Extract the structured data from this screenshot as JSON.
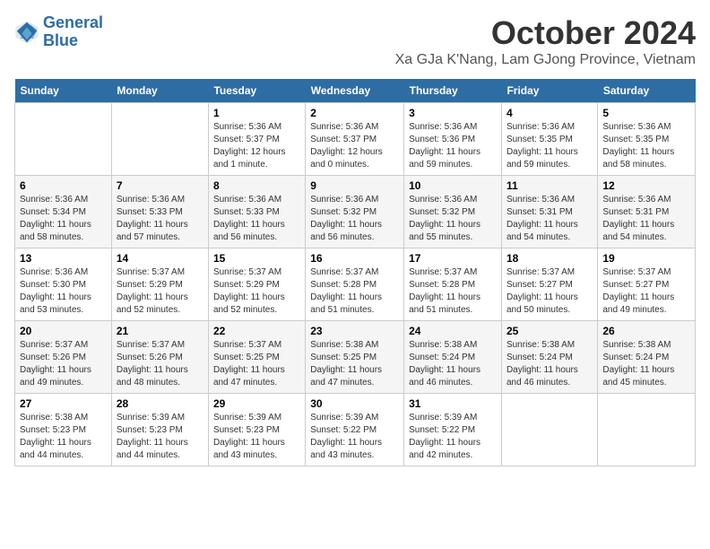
{
  "logo": {
    "line1": "General",
    "line2": "Blue"
  },
  "title": "October 2024",
  "location": "Xa GJa K'Nang, Lam GJong Province, Vietnam",
  "days_of_week": [
    "Sunday",
    "Monday",
    "Tuesday",
    "Wednesday",
    "Thursday",
    "Friday",
    "Saturday"
  ],
  "weeks": [
    [
      {
        "day": "",
        "sunrise": "",
        "sunset": "",
        "daylight": ""
      },
      {
        "day": "",
        "sunrise": "",
        "sunset": "",
        "daylight": ""
      },
      {
        "day": "1",
        "sunrise": "Sunrise: 5:36 AM",
        "sunset": "Sunset: 5:37 PM",
        "daylight": "Daylight: 12 hours and 1 minute."
      },
      {
        "day": "2",
        "sunrise": "Sunrise: 5:36 AM",
        "sunset": "Sunset: 5:37 PM",
        "daylight": "Daylight: 12 hours and 0 minutes."
      },
      {
        "day": "3",
        "sunrise": "Sunrise: 5:36 AM",
        "sunset": "Sunset: 5:36 PM",
        "daylight": "Daylight: 11 hours and 59 minutes."
      },
      {
        "day": "4",
        "sunrise": "Sunrise: 5:36 AM",
        "sunset": "Sunset: 5:35 PM",
        "daylight": "Daylight: 11 hours and 59 minutes."
      },
      {
        "day": "5",
        "sunrise": "Sunrise: 5:36 AM",
        "sunset": "Sunset: 5:35 PM",
        "daylight": "Daylight: 11 hours and 58 minutes."
      }
    ],
    [
      {
        "day": "6",
        "sunrise": "Sunrise: 5:36 AM",
        "sunset": "Sunset: 5:34 PM",
        "daylight": "Daylight: 11 hours and 58 minutes."
      },
      {
        "day": "7",
        "sunrise": "Sunrise: 5:36 AM",
        "sunset": "Sunset: 5:33 PM",
        "daylight": "Daylight: 11 hours and 57 minutes."
      },
      {
        "day": "8",
        "sunrise": "Sunrise: 5:36 AM",
        "sunset": "Sunset: 5:33 PM",
        "daylight": "Daylight: 11 hours and 56 minutes."
      },
      {
        "day": "9",
        "sunrise": "Sunrise: 5:36 AM",
        "sunset": "Sunset: 5:32 PM",
        "daylight": "Daylight: 11 hours and 56 minutes."
      },
      {
        "day": "10",
        "sunrise": "Sunrise: 5:36 AM",
        "sunset": "Sunset: 5:32 PM",
        "daylight": "Daylight: 11 hours and 55 minutes."
      },
      {
        "day": "11",
        "sunrise": "Sunrise: 5:36 AM",
        "sunset": "Sunset: 5:31 PM",
        "daylight": "Daylight: 11 hours and 54 minutes."
      },
      {
        "day": "12",
        "sunrise": "Sunrise: 5:36 AM",
        "sunset": "Sunset: 5:31 PM",
        "daylight": "Daylight: 11 hours and 54 minutes."
      }
    ],
    [
      {
        "day": "13",
        "sunrise": "Sunrise: 5:36 AM",
        "sunset": "Sunset: 5:30 PM",
        "daylight": "Daylight: 11 hours and 53 minutes."
      },
      {
        "day": "14",
        "sunrise": "Sunrise: 5:37 AM",
        "sunset": "Sunset: 5:29 PM",
        "daylight": "Daylight: 11 hours and 52 minutes."
      },
      {
        "day": "15",
        "sunrise": "Sunrise: 5:37 AM",
        "sunset": "Sunset: 5:29 PM",
        "daylight": "Daylight: 11 hours and 52 minutes."
      },
      {
        "day": "16",
        "sunrise": "Sunrise: 5:37 AM",
        "sunset": "Sunset: 5:28 PM",
        "daylight": "Daylight: 11 hours and 51 minutes."
      },
      {
        "day": "17",
        "sunrise": "Sunrise: 5:37 AM",
        "sunset": "Sunset: 5:28 PM",
        "daylight": "Daylight: 11 hours and 51 minutes."
      },
      {
        "day": "18",
        "sunrise": "Sunrise: 5:37 AM",
        "sunset": "Sunset: 5:27 PM",
        "daylight": "Daylight: 11 hours and 50 minutes."
      },
      {
        "day": "19",
        "sunrise": "Sunrise: 5:37 AM",
        "sunset": "Sunset: 5:27 PM",
        "daylight": "Daylight: 11 hours and 49 minutes."
      }
    ],
    [
      {
        "day": "20",
        "sunrise": "Sunrise: 5:37 AM",
        "sunset": "Sunset: 5:26 PM",
        "daylight": "Daylight: 11 hours and 49 minutes."
      },
      {
        "day": "21",
        "sunrise": "Sunrise: 5:37 AM",
        "sunset": "Sunset: 5:26 PM",
        "daylight": "Daylight: 11 hours and 48 minutes."
      },
      {
        "day": "22",
        "sunrise": "Sunrise: 5:37 AM",
        "sunset": "Sunset: 5:25 PM",
        "daylight": "Daylight: 11 hours and 47 minutes."
      },
      {
        "day": "23",
        "sunrise": "Sunrise: 5:38 AM",
        "sunset": "Sunset: 5:25 PM",
        "daylight": "Daylight: 11 hours and 47 minutes."
      },
      {
        "day": "24",
        "sunrise": "Sunrise: 5:38 AM",
        "sunset": "Sunset: 5:24 PM",
        "daylight": "Daylight: 11 hours and 46 minutes."
      },
      {
        "day": "25",
        "sunrise": "Sunrise: 5:38 AM",
        "sunset": "Sunset: 5:24 PM",
        "daylight": "Daylight: 11 hours and 46 minutes."
      },
      {
        "day": "26",
        "sunrise": "Sunrise: 5:38 AM",
        "sunset": "Sunset: 5:24 PM",
        "daylight": "Daylight: 11 hours and 45 minutes."
      }
    ],
    [
      {
        "day": "27",
        "sunrise": "Sunrise: 5:38 AM",
        "sunset": "Sunset: 5:23 PM",
        "daylight": "Daylight: 11 hours and 44 minutes."
      },
      {
        "day": "28",
        "sunrise": "Sunrise: 5:39 AM",
        "sunset": "Sunset: 5:23 PM",
        "daylight": "Daylight: 11 hours and 44 minutes."
      },
      {
        "day": "29",
        "sunrise": "Sunrise: 5:39 AM",
        "sunset": "Sunset: 5:23 PM",
        "daylight": "Daylight: 11 hours and 43 minutes."
      },
      {
        "day": "30",
        "sunrise": "Sunrise: 5:39 AM",
        "sunset": "Sunset: 5:22 PM",
        "daylight": "Daylight: 11 hours and 43 minutes."
      },
      {
        "day": "31",
        "sunrise": "Sunrise: 5:39 AM",
        "sunset": "Sunset: 5:22 PM",
        "daylight": "Daylight: 11 hours and 42 minutes."
      },
      {
        "day": "",
        "sunrise": "",
        "sunset": "",
        "daylight": ""
      },
      {
        "day": "",
        "sunrise": "",
        "sunset": "",
        "daylight": ""
      }
    ]
  ]
}
